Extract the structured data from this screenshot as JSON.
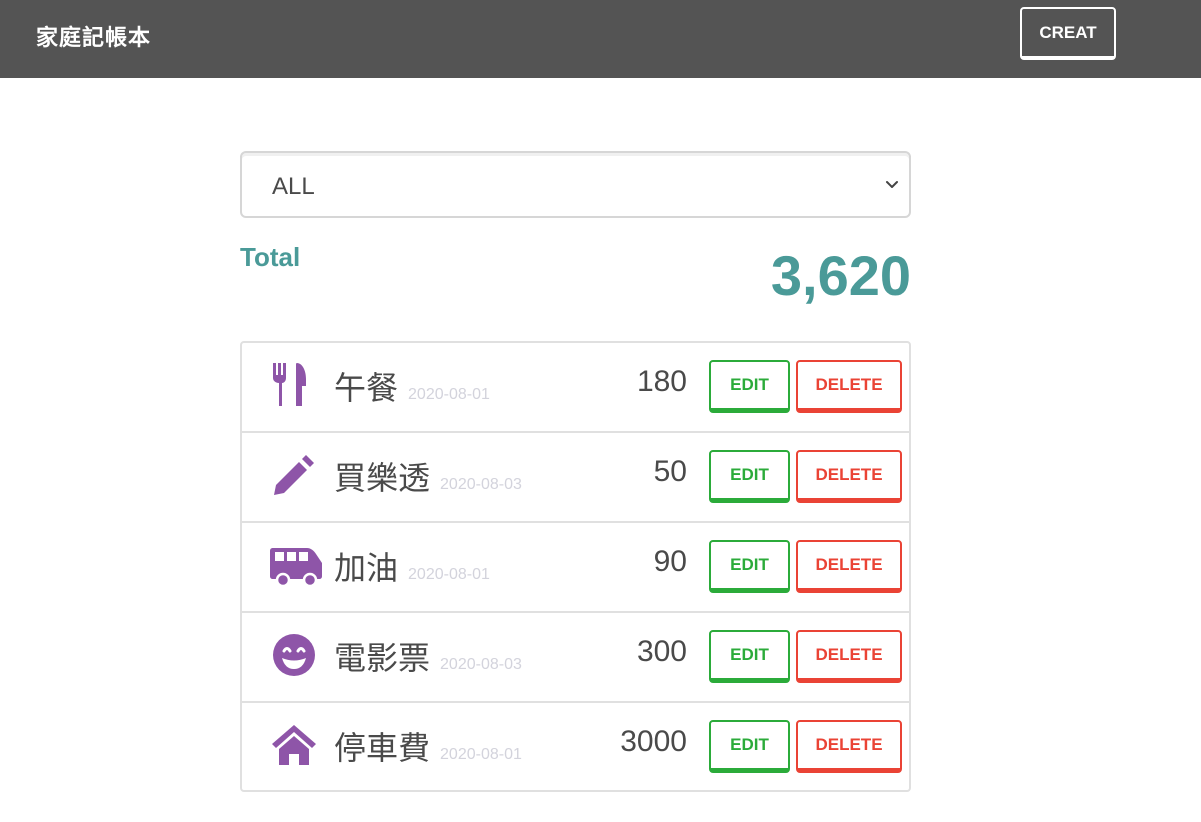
{
  "navbar": {
    "brand": "家庭記帳本",
    "create_label": "CREAT"
  },
  "filter": {
    "selected": "ALL"
  },
  "total": {
    "label": "Total",
    "value": "3,620"
  },
  "records": [
    {
      "icon": "utensils-icon",
      "title": "午餐",
      "date": "2020-08-01",
      "amount": "180"
    },
    {
      "icon": "pencil-icon",
      "title": "買樂透",
      "date": "2020-08-03",
      "amount": "50"
    },
    {
      "icon": "shuttle-van-icon",
      "title": "加油",
      "date": "2020-08-01",
      "amount": "90"
    },
    {
      "icon": "grin-icon",
      "title": "電影票",
      "date": "2020-08-03",
      "amount": "300"
    },
    {
      "icon": "home-icon",
      "title": "停車費",
      "date": "2020-08-01",
      "amount": "3000"
    }
  ],
  "actions": {
    "edit_label": "EDIT",
    "delete_label": "DELETE"
  },
  "colors": {
    "navbar": "#545454",
    "accent": "#4a9a98",
    "icon": "#8e55a8",
    "edit": "#2bab3a",
    "delete": "#ea4335"
  }
}
